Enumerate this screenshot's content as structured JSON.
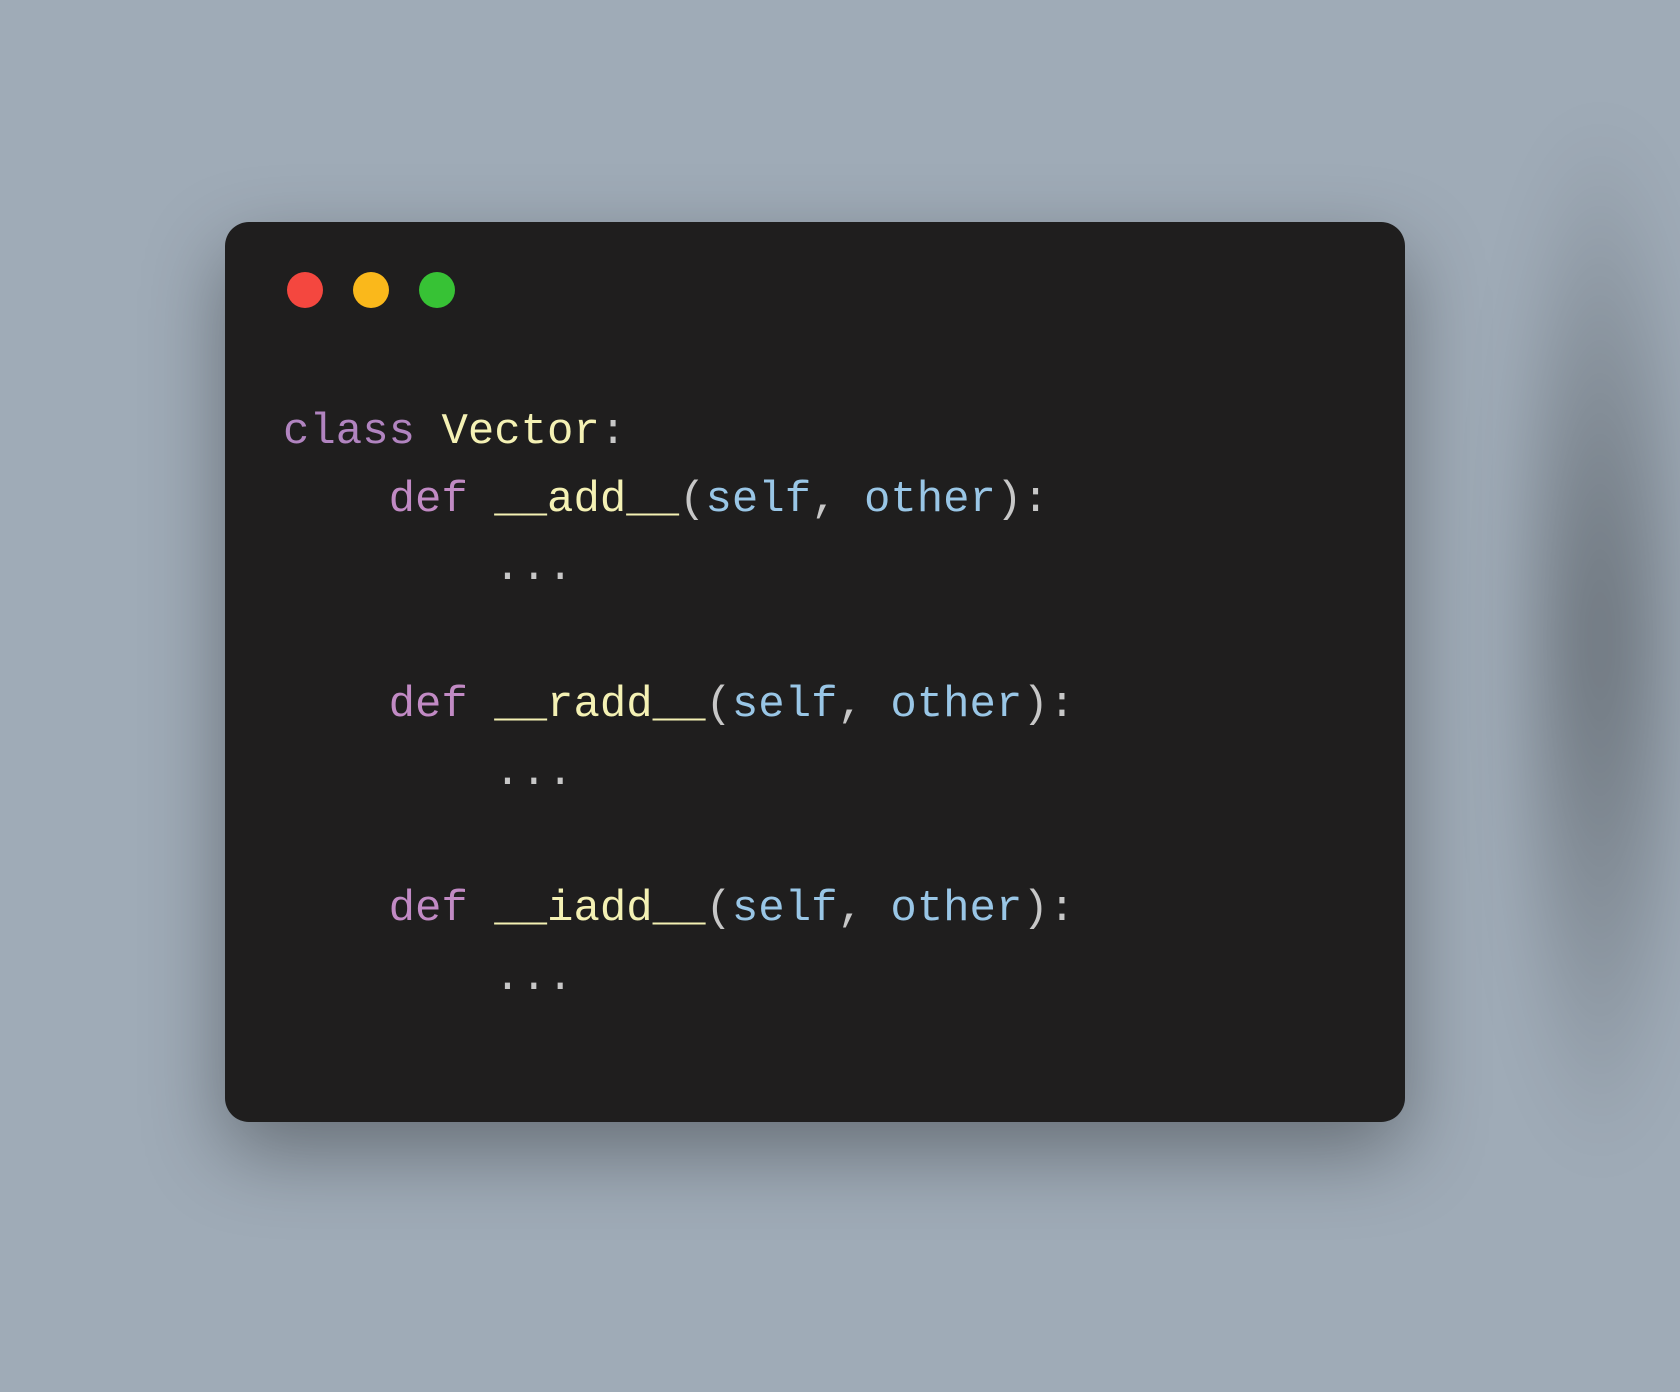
{
  "window": {
    "traffic_lights": {
      "red": "#f4473f",
      "yellow": "#fab81b",
      "green": "#37c235"
    }
  },
  "code": {
    "keyword_class": "class",
    "class_name": "Vector",
    "class_colon": ":",
    "indent1": "    ",
    "indent2": "        ",
    "ellipsis": "...",
    "methods": [
      {
        "keyword_def": "def",
        "name": "__add__",
        "open_paren": "(",
        "param1": "self",
        "comma": ", ",
        "param2": "other",
        "close_paren_colon": "):"
      },
      {
        "keyword_def": "def",
        "name": "__radd__",
        "open_paren": "(",
        "param1": "self",
        "comma": ", ",
        "param2": "other",
        "close_paren_colon": "):"
      },
      {
        "keyword_def": "def",
        "name": "__iadd__",
        "open_paren": "(",
        "param1": "self",
        "comma": ", ",
        "param2": "other",
        "close_paren_colon": "):"
      }
    ]
  },
  "colors": {
    "background": "#9fabb7",
    "window_bg": "#1f1e1e",
    "keyword": "#b184c0",
    "classname": "#f4f1b4",
    "param": "#99c6e6",
    "default": "#d6d6d6"
  }
}
